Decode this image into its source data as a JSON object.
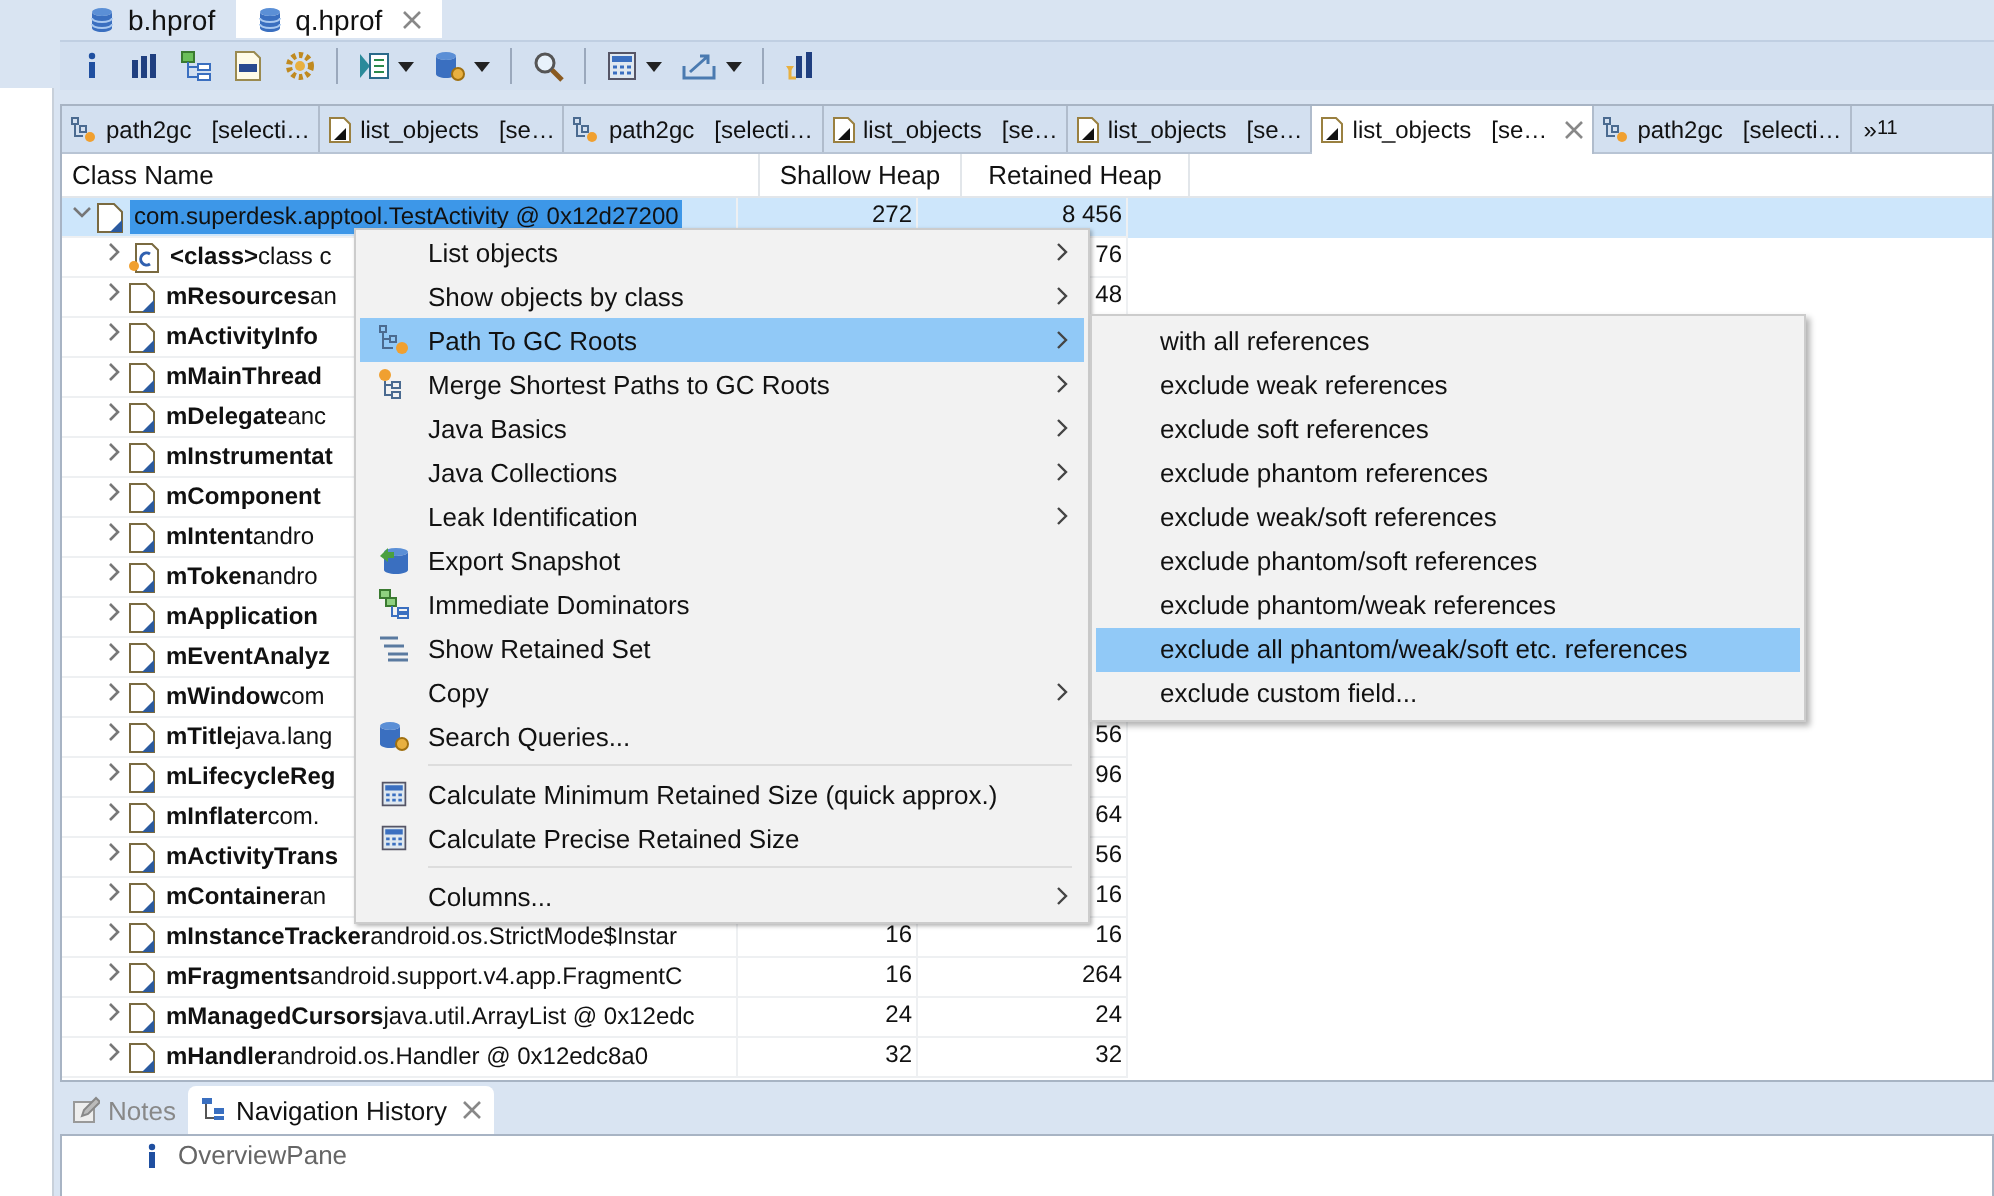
{
  "editor_tabs": [
    {
      "label": "b.hprof",
      "selected": false,
      "closable": false
    },
    {
      "label": "q.hprof",
      "selected": true,
      "closable": true
    }
  ],
  "result_tabs": [
    {
      "kind": "path",
      "label": "path2gc",
      "detail": "[selecti…",
      "selected": false
    },
    {
      "kind": "list",
      "label": "list_objects",
      "detail": "[se…",
      "selected": false
    },
    {
      "kind": "path",
      "label": "path2gc",
      "detail": "[selecti…",
      "selected": false
    },
    {
      "kind": "list",
      "label": "list_objects",
      "detail": "[se…",
      "selected": false
    },
    {
      "kind": "list",
      "label": "list_objects",
      "detail": "[se…",
      "selected": false
    },
    {
      "kind": "list",
      "label": "list_objects",
      "detail": "[se…",
      "selected": true
    },
    {
      "kind": "path",
      "label": "path2gc",
      "detail": "[selecti…",
      "selected": false
    }
  ],
  "tab_overflow": {
    "mark": "»",
    "count": "11"
  },
  "table": {
    "columns": [
      "Class Name",
      "Shallow Heap",
      "Retained Heap"
    ],
    "rows": [
      {
        "kind": "object",
        "name": "com.superdesk.apptool.TestActivity @ 0x12d27200",
        "shallow": "272",
        "retained": "8 456",
        "selected": true,
        "expanded": true,
        "children": [
          {
            "kind": "class",
            "name": "<class>",
            "detail": "class c",
            "retained": "76",
            "selected": false,
            "expanded": false
          },
          {
            "kind": "object",
            "name": "mResources",
            "detail": "an",
            "retained": "48",
            "selected": false,
            "expanded": false
          },
          {
            "kind": "object",
            "name": "mActivityInfo",
            "selected": false,
            "expanded": false
          },
          {
            "kind": "object",
            "name": "mMainThread",
            "selected": false,
            "expanded": false
          },
          {
            "kind": "object",
            "name": "mDelegate",
            "detail": "anc",
            "selected": false,
            "expanded": false
          },
          {
            "kind": "object",
            "name": "mInstrumentat",
            "selected": false,
            "expanded": false
          },
          {
            "kind": "object",
            "name": "mComponent",
            "selected": false,
            "expanded": false
          },
          {
            "kind": "object",
            "name": "mIntent",
            "detail": "andro",
            "selected": false,
            "expanded": false
          },
          {
            "kind": "object",
            "name": "mToken",
            "detail": "andro",
            "selected": false,
            "expanded": false
          },
          {
            "kind": "object",
            "name": "mApplication",
            "selected": false,
            "expanded": false
          },
          {
            "kind": "object",
            "name": "mEventAnalyz",
            "selected": false,
            "expanded": false
          },
          {
            "kind": "object",
            "name": "mWindow",
            "detail": "com",
            "selected": false,
            "expanded": false
          },
          {
            "kind": "object",
            "name": "mTitle",
            "detail": "java.lang",
            "retained": "56",
            "selected": false,
            "expanded": false
          },
          {
            "kind": "object",
            "name": "mLifecycleReg",
            "retained": "96",
            "selected": false,
            "expanded": false
          },
          {
            "kind": "object",
            "name": "mInflater",
            "detail": "com.",
            "retained": "64",
            "selected": false,
            "expanded": false
          },
          {
            "kind": "object",
            "name": "mActivityTrans",
            "retained": "56",
            "selected": false,
            "expanded": false
          },
          {
            "kind": "object",
            "name": "mContainer",
            "detail": "an",
            "retained": "16",
            "selected": false,
            "expanded": false
          },
          {
            "kind": "object",
            "name": "mInstanceTracker",
            "detail": "android.os.StrictMode$Instar",
            "shallow": "16",
            "retained": "16",
            "selected": false,
            "expanded": false
          },
          {
            "kind": "object",
            "name": "mFragments",
            "detail": "android.support.v4.app.FragmentC",
            "shallow": "16",
            "retained": "264",
            "selected": false,
            "expanded": false
          },
          {
            "kind": "object",
            "name": "mManagedCursors",
            "detail": "java.util.ArrayList @ 0x12edc",
            "shallow": "24",
            "retained": "24",
            "selected": false,
            "expanded": false
          },
          {
            "kind": "object",
            "name": "mHandler",
            "detail": "android.os.Handler @ 0x12edc8a0",
            "shallow": "32",
            "retained": "32",
            "selected": false,
            "expanded": false
          }
        ]
      }
    ]
  },
  "context_menu": [
    {
      "kind": "plain",
      "label": "List objects",
      "submenu": true,
      "selected": false
    },
    {
      "kind": "plain",
      "label": "Show objects by class",
      "submenu": true,
      "selected": false
    },
    {
      "kind": "path",
      "label": "Path To GC Roots",
      "submenu": true,
      "selected": true
    },
    {
      "kind": "merge",
      "label": "Merge Shortest Paths to GC Roots",
      "submenu": true,
      "selected": false
    },
    {
      "kind": "plain",
      "label": "Java Basics",
      "submenu": true,
      "selected": false
    },
    {
      "kind": "plain",
      "label": "Java Collections",
      "submenu": true,
      "selected": false
    },
    {
      "kind": "plain",
      "label": "Leak Identification",
      "submenu": true,
      "selected": false
    },
    {
      "kind": "export",
      "label": "Export Snapshot",
      "submenu": false,
      "selected": false
    },
    {
      "kind": "dominators",
      "label": "Immediate Dominators",
      "submenu": false,
      "selected": false
    },
    {
      "kind": "retained",
      "label": "Show Retained Set",
      "submenu": false,
      "selected": false
    },
    {
      "kind": "plain",
      "label": "Copy",
      "submenu": true,
      "selected": false
    },
    {
      "kind": "search",
      "label": "Search Queries...",
      "submenu": false,
      "selected": false
    },
    {
      "kind": "separator"
    },
    {
      "kind": "calculator",
      "label": "Calculate Minimum Retained Size (quick approx.)",
      "submenu": false,
      "selected": false
    },
    {
      "kind": "calculator",
      "label": "Calculate Precise Retained Size",
      "submenu": false,
      "selected": false
    },
    {
      "kind": "separator"
    },
    {
      "kind": "plain",
      "label": "Columns...",
      "submenu": true,
      "selected": false
    }
  ],
  "submenu": [
    {
      "label": "with all references",
      "selected": false
    },
    {
      "label": "exclude weak references",
      "selected": false
    },
    {
      "label": "exclude soft references",
      "selected": false
    },
    {
      "label": "exclude phantom references",
      "selected": false
    },
    {
      "label": "exclude weak/soft references",
      "selected": false
    },
    {
      "label": "exclude phantom/soft references",
      "selected": false
    },
    {
      "label": "exclude phantom/weak references",
      "selected": false
    },
    {
      "label": "exclude all phantom/weak/soft etc. references",
      "selected": true
    },
    {
      "label": "exclude custom field...",
      "selected": false
    }
  ],
  "bottom_tabs": [
    {
      "kind": "notes",
      "label": "Notes",
      "selected": false,
      "closable": false
    },
    {
      "kind": "history",
      "label": "Navigation History",
      "selected": true,
      "closable": true
    }
  ],
  "navigation_history": [
    {
      "kind": "info",
      "label": "OverviewPane"
    }
  ]
}
